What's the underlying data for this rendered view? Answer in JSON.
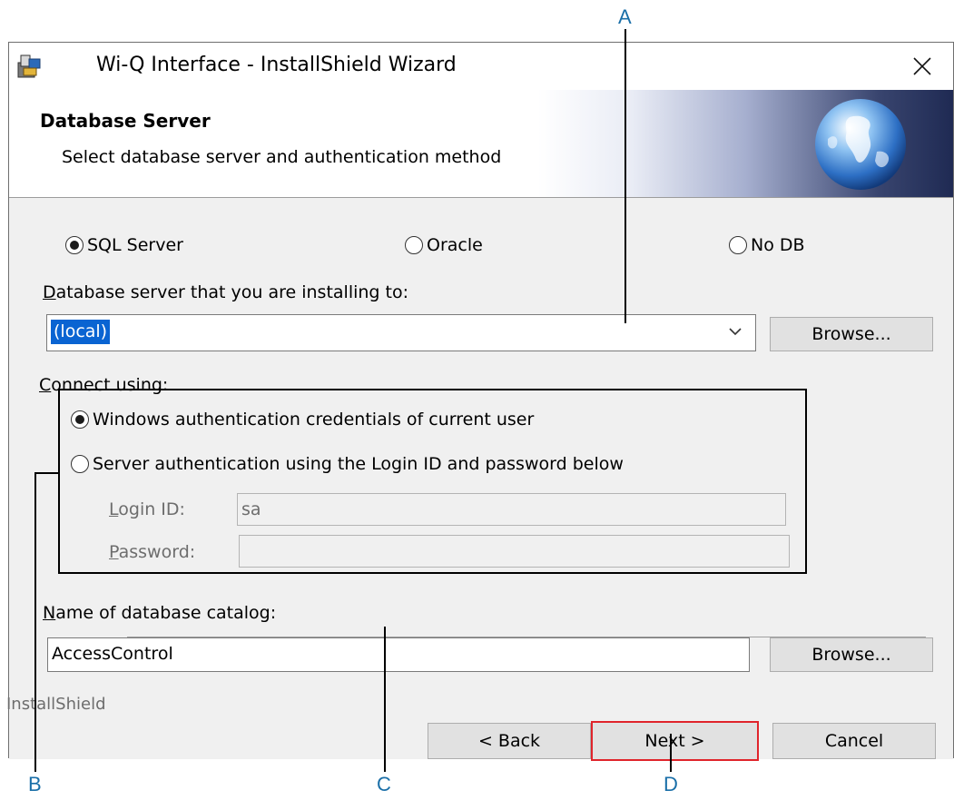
{
  "window": {
    "title": "Wi-Q Interface - InstallShield Wizard",
    "icons": {
      "app": "installer-icon",
      "close": "close-icon"
    }
  },
  "banner": {
    "title": "Database Server",
    "subtitle": "Select database server and authentication method",
    "image": "globe-icon"
  },
  "db_type": {
    "options": [
      "SQL Server",
      "Oracle",
      "No DB"
    ],
    "selected": "SQL Server"
  },
  "server": {
    "label_underlined": "D",
    "label_rest": "atabase server that you are installing to:",
    "value": "(local)",
    "browse_label": "Browse..."
  },
  "connect": {
    "label_underlined": "C",
    "label_rest": "onnect using:",
    "options": [
      "Windows authentication credentials of current user",
      "Server authentication using the Login ID and password below"
    ],
    "selected": "Windows authentication credentials of current user",
    "login_label_underlined": "L",
    "login_label_rest": "ogin ID:",
    "login_value": "sa",
    "password_label_underlined": "P",
    "password_label_rest": "assword:",
    "password_value": ""
  },
  "catalog": {
    "label_underlined": "N",
    "label_rest": "ame of database catalog:",
    "value": "AccessControl",
    "browse_label": "Browse..."
  },
  "footer": {
    "brand": "InstallShield",
    "back_label": "< Back",
    "next_label": "Next >",
    "cancel_label": "Cancel"
  },
  "callouts": [
    "A",
    "B",
    "C",
    "D"
  ],
  "colors": {
    "accent": "#0a64d2",
    "highlight_border": "#e0242b",
    "callout_text": "#1a6fa8",
    "dialog_bg": "#f0f0f0"
  }
}
